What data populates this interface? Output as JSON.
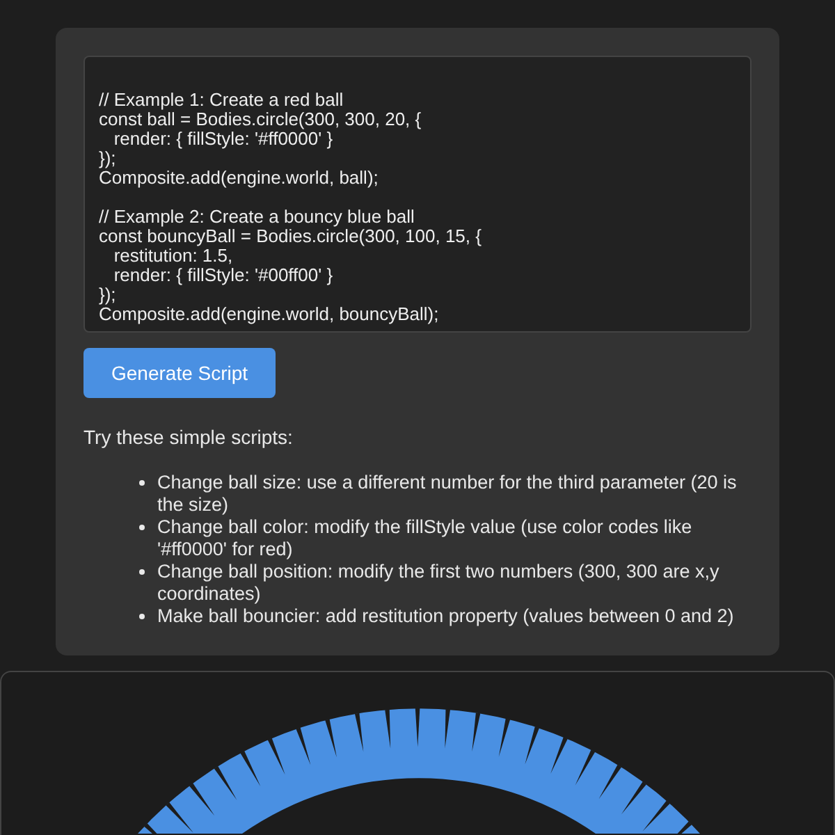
{
  "editor": {
    "code": "// Example 1: Create a red ball\nconst ball = Bodies.circle(300, 300, 20, {\n   render: { fillStyle: '#ff0000' }\n});\nComposite.add(engine.world, ball);\n\n// Example 2: Create a bouncy blue ball\nconst bouncyBall = Bodies.circle(300, 100, 15, {\n   restitution: 1.5,\n   render: { fillStyle: '#00ff00' }\n});\nComposite.add(engine.world, bouncyBall);"
  },
  "button": {
    "label": "Generate Script"
  },
  "help": {
    "heading": "Try these simple scripts:",
    "items": [
      "Change ball size: use a different number for the third parameter (20 is the size)",
      "Change ball color: modify the fillStyle value (use color codes like '#ff0000' for red)",
      "Change ball position: modify the first two numbers (300, 300 are x,y coordinates)",
      "Make ball bouncier: add restitution property (values between 0 and 2)"
    ]
  }
}
